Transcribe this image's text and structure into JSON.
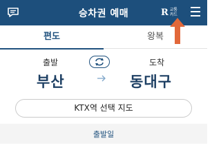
{
  "header": {
    "title": "승차권 예매",
    "rail_card_logo": "R",
    "rail_card_text_line1": "교통",
    "rail_card_text_line2": "카드",
    "bg_color": "#1d4f7c",
    "icons": [
      "chat-icon",
      "rail-card-icon",
      "menu-icon"
    ]
  },
  "annotation": {
    "color": "#e2683a",
    "icon": "arrow-up-icon"
  },
  "tabs": [
    {
      "label": "편도",
      "active": true
    },
    {
      "label": "왕복",
      "active": false
    }
  ],
  "route": {
    "departure_label": "출발",
    "arrival_label": "도착",
    "departure_station": "부산",
    "arrival_station": "동대구",
    "swap_icon": "swap-icon",
    "direction_icon": "arrow-right-icon"
  },
  "station_map_button": "KTX역 선택 지도",
  "date_section": {
    "label": "출발일"
  }
}
